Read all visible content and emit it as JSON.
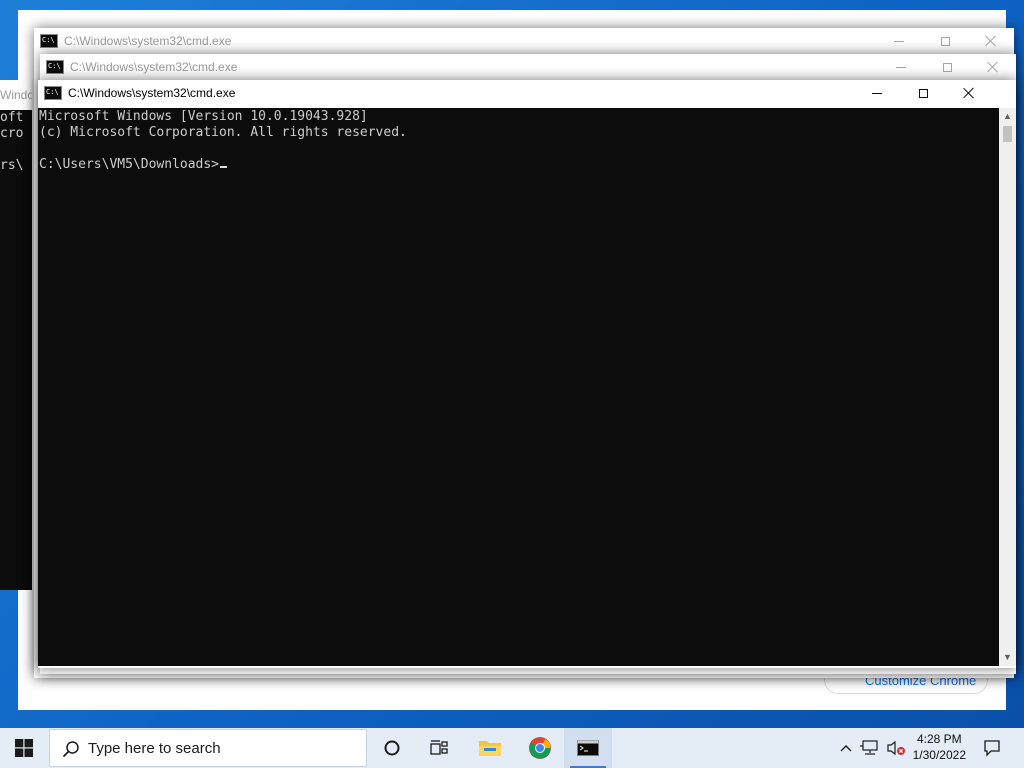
{
  "desktop": {
    "chrome_customize_label": "Customize Chrome"
  },
  "left_window": {
    "title": "Windo",
    "lines": [
      "oft",
      "cro",
      "",
      "rs\\"
    ]
  },
  "windows": [
    {
      "title": "C:\\Windows\\system32\\cmd.exe",
      "state": "inactive"
    },
    {
      "title": "C:\\Windows\\system32\\cmd.exe",
      "state": "inactive"
    },
    {
      "title": "C:\\Windows\\system32\\cmd.exe",
      "state": "active"
    }
  ],
  "console": {
    "line1": "Microsoft Windows [Version 10.0.19043.928]",
    "line2": "(c) Microsoft Corporation. All rights reserved.",
    "line3": "",
    "prompt": "C:\\Users\\VM5\\Downloads>"
  },
  "taskbar": {
    "search_placeholder": "Type here to search",
    "time": "4:28 PM",
    "date": "1/30/2022",
    "apps": [
      "start-icon",
      "cortana-icon",
      "task-view-icon",
      "file-explorer-icon",
      "chrome-icon",
      "cmd-icon"
    ]
  },
  "colors": {
    "console_bg": "#0c0c0c",
    "console_fg": "#cccccc",
    "taskbar_bg": "#e4ecf6",
    "desktop": "#0d62c4"
  }
}
